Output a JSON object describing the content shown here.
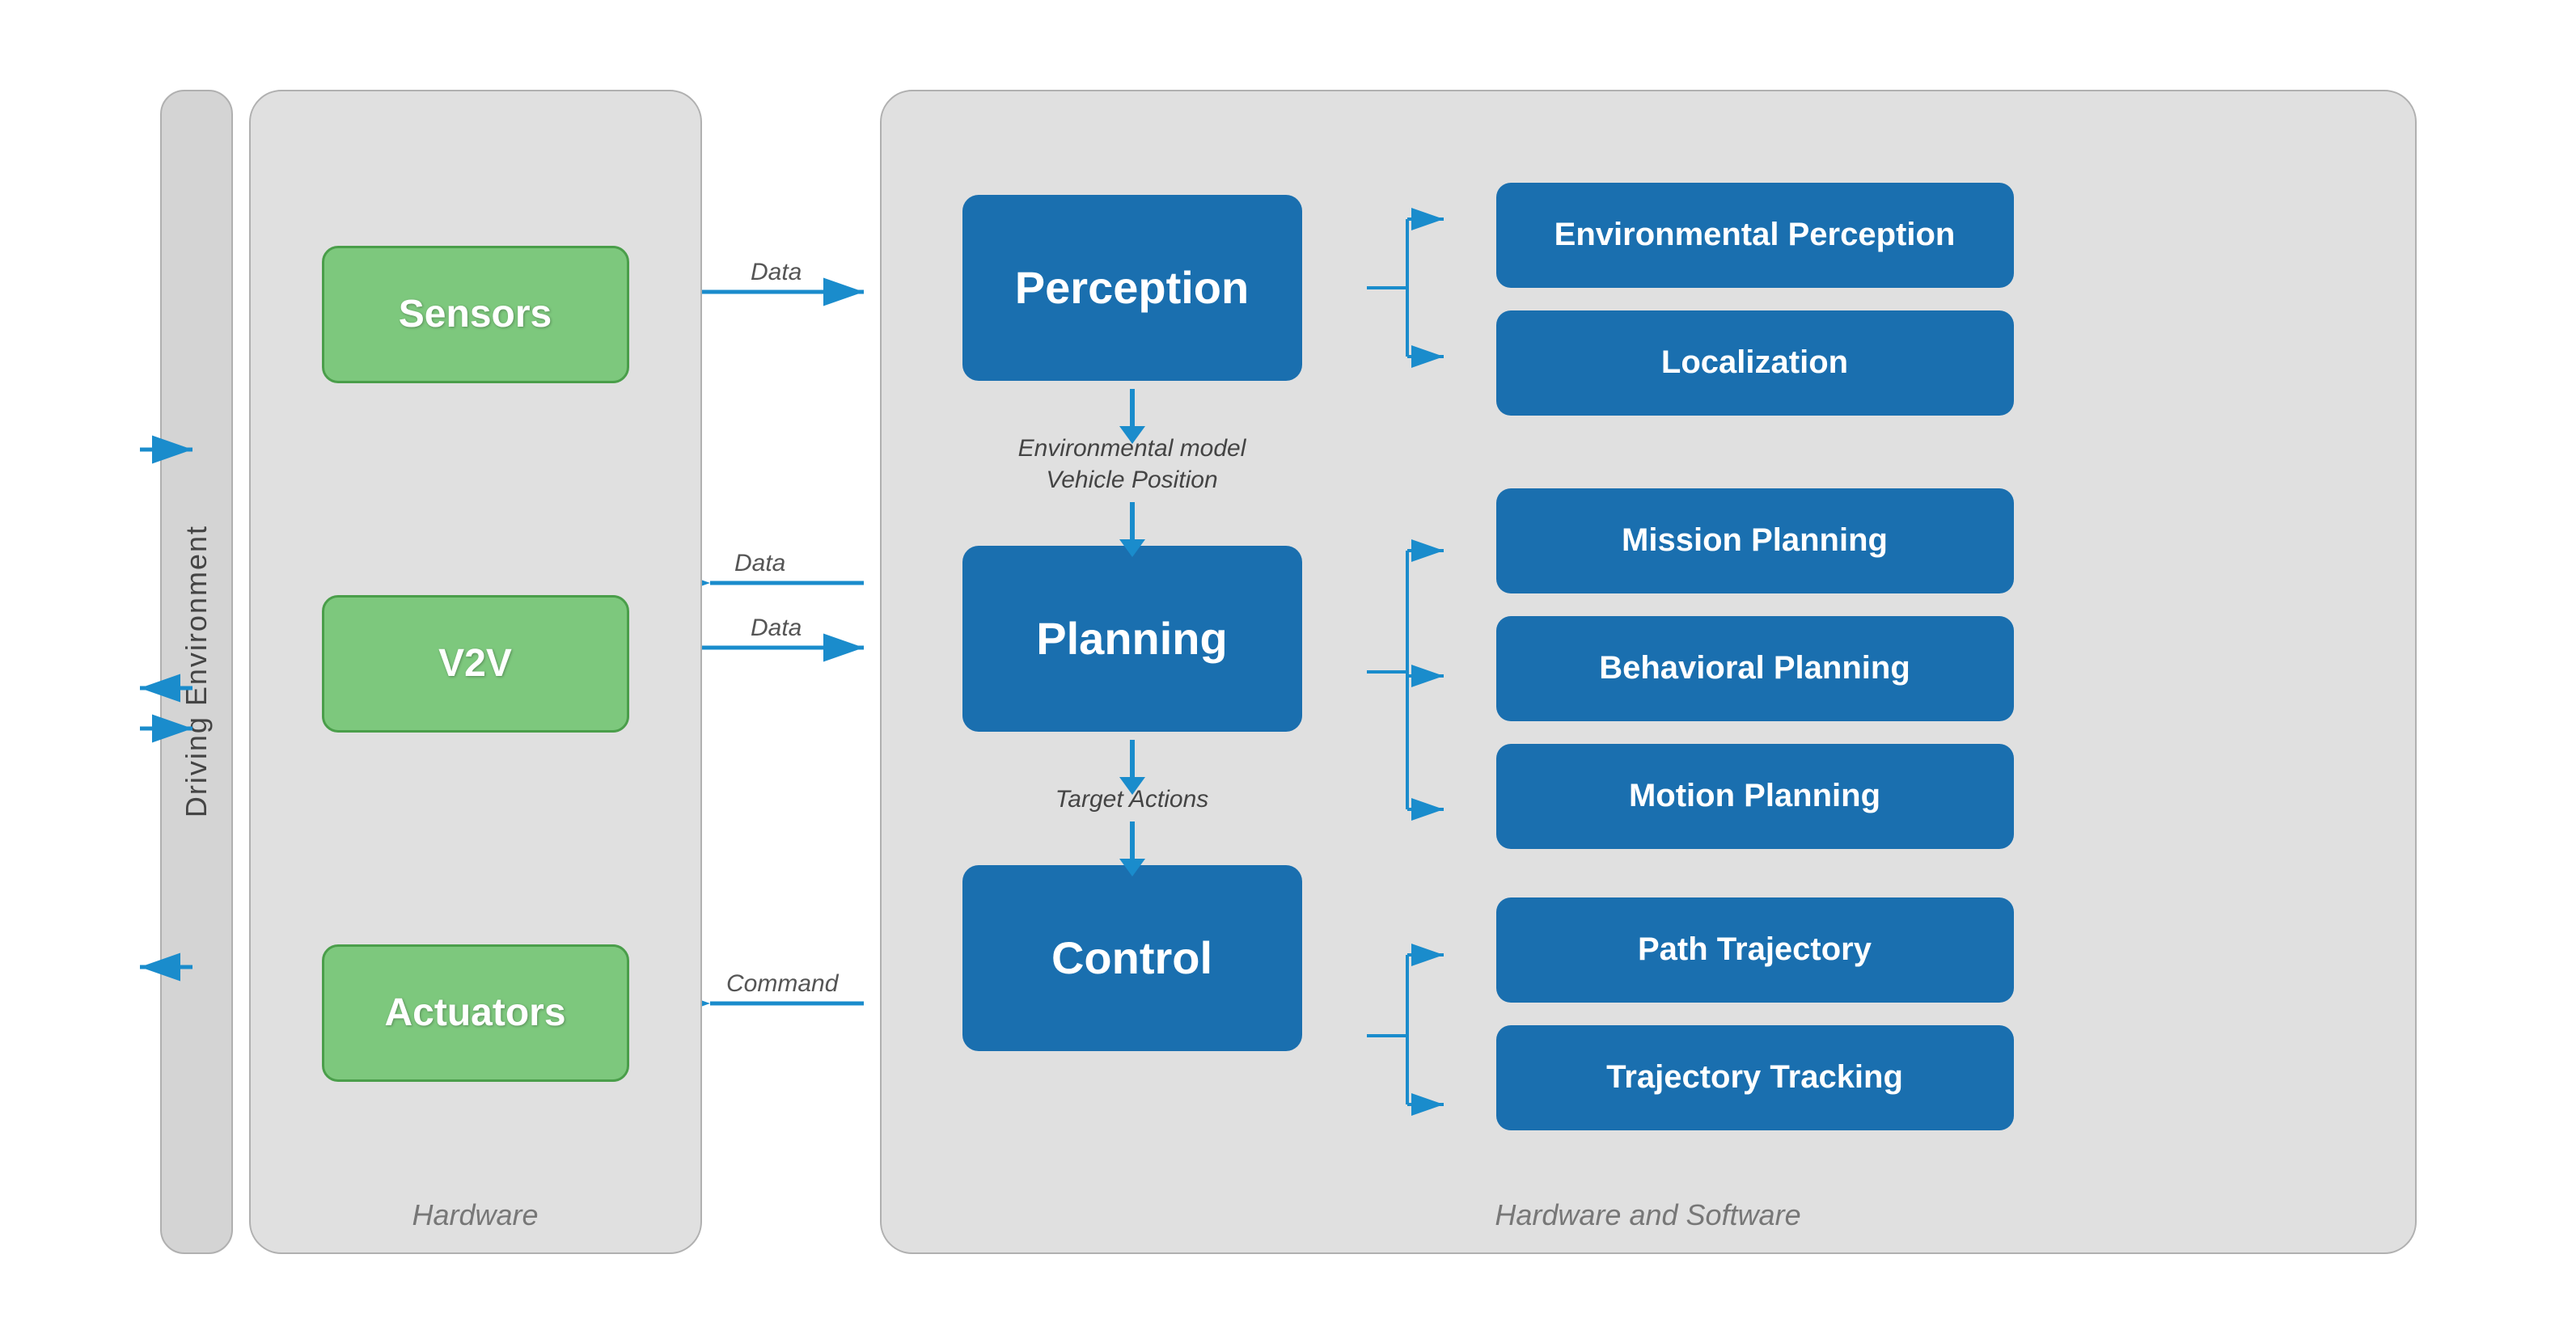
{
  "diagram": {
    "drivingEnv": {
      "label": "Driving Environment"
    },
    "hardware": {
      "panelLabel": "Hardware",
      "boxes": [
        {
          "id": "sensors",
          "label": "Sensors"
        },
        {
          "id": "v2v",
          "label": "V2V"
        },
        {
          "id": "actuators",
          "label": "Actuators"
        }
      ]
    },
    "connections": {
      "labels": [
        "Data",
        "Data",
        "Data",
        "Command"
      ]
    },
    "hwSw": {
      "panelLabel": "Hardware and Software",
      "mainBoxes": [
        {
          "id": "perception",
          "label": "Perception"
        },
        {
          "id": "planning",
          "label": "Planning"
        },
        {
          "id": "control",
          "label": "Control"
        }
      ],
      "flowLabels": [
        {
          "id": "env-model",
          "text": "Environmental model\nVehicle Position"
        },
        {
          "id": "target-actions",
          "text": "Target Actions"
        }
      ],
      "subBoxes": {
        "perception": [
          {
            "id": "env-perception",
            "label": "Environmental Perception"
          },
          {
            "id": "localization",
            "label": "Localization"
          }
        ],
        "planning": [
          {
            "id": "mission-planning",
            "label": "Mission Planning"
          },
          {
            "id": "behavioral-planning",
            "label": "Behavioral Planning"
          },
          {
            "id": "motion-planning",
            "label": "Motion Planning"
          }
        ],
        "control": [
          {
            "id": "path-trajectory",
            "label": "Path Trajectory"
          },
          {
            "id": "trajectory-tracking",
            "label": "Trajectory Tracking"
          }
        ]
      }
    }
  }
}
